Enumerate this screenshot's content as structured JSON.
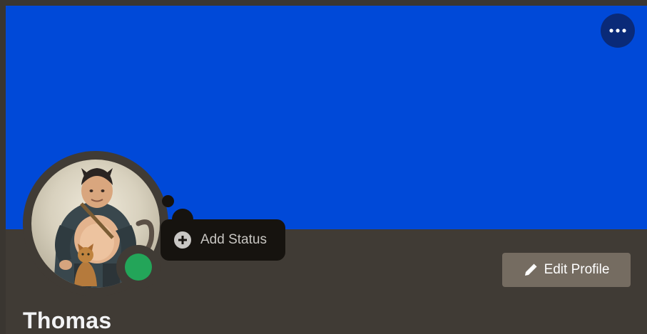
{
  "profile": {
    "banner_color": "#0049d8",
    "username": "Thomas",
    "presence": "online",
    "presence_color": "#23a559",
    "avatar_icon": "avatar-image"
  },
  "actions": {
    "more_icon": "more-horizontal-icon",
    "add_status_icon": "plus-circle-icon",
    "add_status_label": "Add Status",
    "edit_icon": "pencil-icon",
    "edit_label": "Edit Profile"
  }
}
